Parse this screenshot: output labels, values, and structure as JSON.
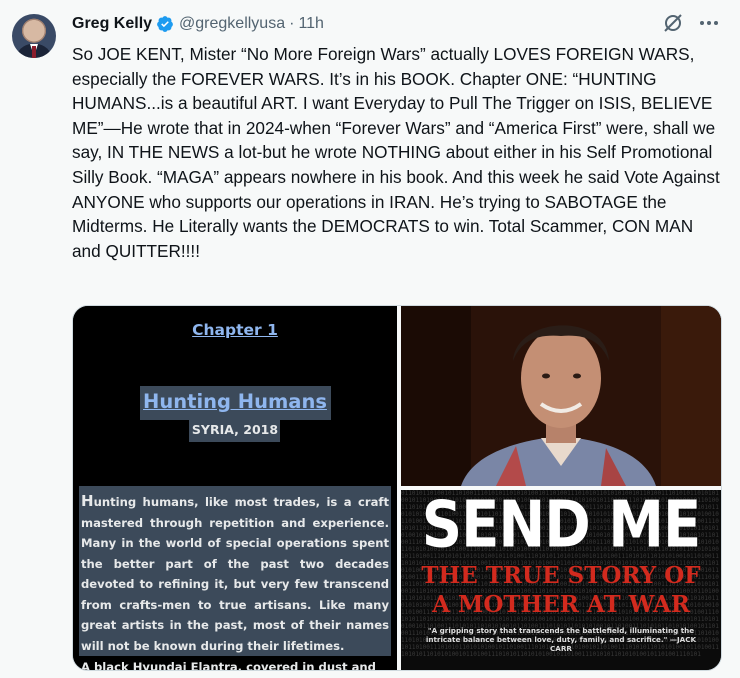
{
  "author": {
    "name": "Greg Kelly",
    "handle": "@gregkellyusa",
    "separator": "·",
    "time": "11h"
  },
  "icons": [
    "verified-badge-icon",
    "grok-icon",
    "more-icon"
  ],
  "colors": {
    "verified": "#1d9bf0",
    "text": "#0f1419",
    "muted": "#536471",
    "background": "#f7f9f9"
  },
  "tweet_text": "So JOE KENT, Mister “No More Foreign Wars” actually LOVES FOREIGN WARS, especially the FOREVER WARS.  It’s in his BOOK.  Chapter ONE: “HUNTING HUMANS...is a beautiful ART.  I want Everyday to Pull The Trigger on ISIS, BELIEVE ME”—He wrote that in 2024-when “Forever Wars” and “America First” were, shall we say, IN THE NEWS a lot-but he wrote NOTHING about either in his Self Promotional Silly Book.  “MAGA” appears nowhere in his book. And this week he said Vote Against ANYONE who supports our operations in IRAN.  He’s trying to SABOTAGE the Midterms.  He Literally wants the DEMOCRATS to win. Total Scammer, CON MAN and QUITTER!!!!",
  "media": {
    "page": {
      "chapter": "Chapter 1",
      "title": "Hunting Humans",
      "location": "SYRIA, 2018",
      "drop_cap": "H",
      "paragraph": "unting humans, like most trades, is a craft mastered through repetition and experience. Many in the world of special operations spent the better part of the past two decades devoted to refining it, but very few transcend from crafts-men to true artisans. Like many great artists in the past, most of their names will not be known during their lifetimes.",
      "next_line": "A black Hyundai Elantra, covered in dust and"
    },
    "book": {
      "title": "SEND ME",
      "subtitle_line1": "THE TRUE STORY OF",
      "subtitle_line2": "A MOTHER AT WAR",
      "blurb": "\"A gripping story that transcends the battlefield, illuminating the intricate balance between love, duty, family, and sacrifice.\" —JACK CARR"
    }
  }
}
